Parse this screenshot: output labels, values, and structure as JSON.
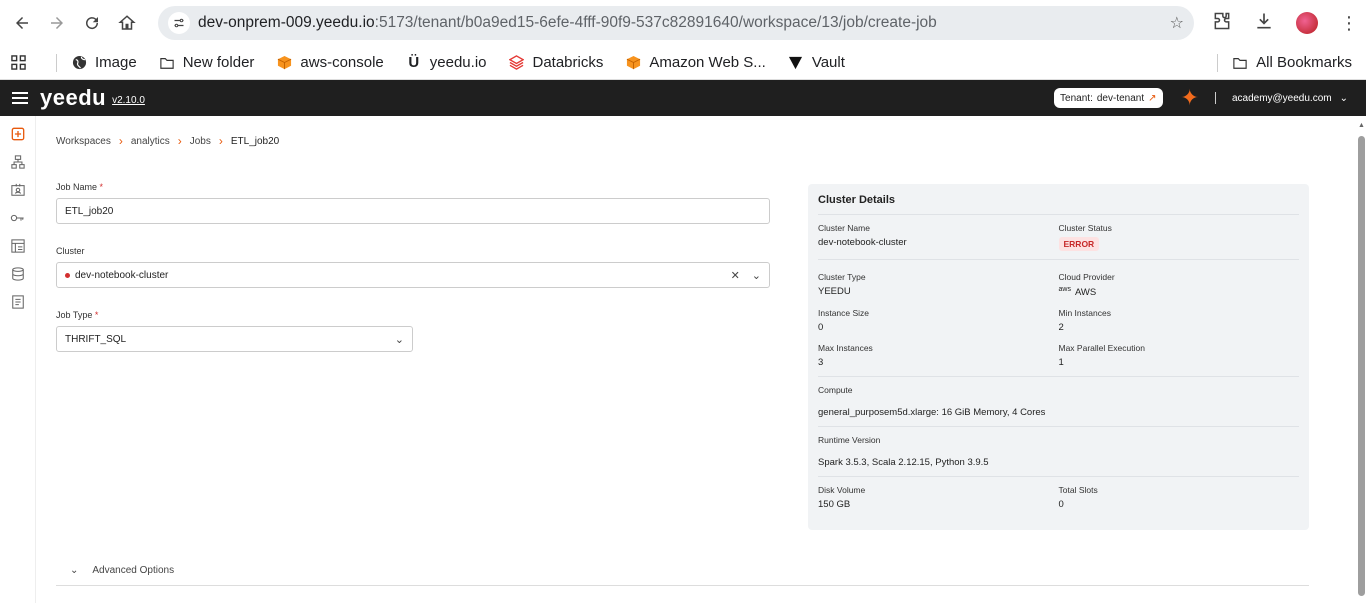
{
  "browser": {
    "url_host": "dev-onprem-009.yeedu.io",
    "url_path": ":5173/tenant/b0a9ed15-6efe-4fff-90f9-537c82891640/workspace/13/job/create-job"
  },
  "bookmarks": {
    "items": [
      "Image",
      "New folder",
      "aws-console",
      "yeedu.io",
      "Databricks",
      "Amazon Web S...",
      "Vault"
    ],
    "all": "All Bookmarks"
  },
  "header": {
    "logo": "yeedu",
    "version": "v2.10.0",
    "tenant_label": "Tenant:",
    "tenant_name": "dev-tenant",
    "user": "academy@yeedu.com"
  },
  "breadcrumb": [
    "Workspaces",
    "analytics",
    "Jobs",
    "ETL_job20"
  ],
  "form": {
    "job_name_label": "Job Name",
    "job_name_value": "ETL_job20",
    "cluster_label": "Cluster",
    "cluster_value": "dev-notebook-cluster",
    "job_type_label": "Job Type",
    "job_type_value": "THRIFT_SQL",
    "required_mark": "*"
  },
  "details": {
    "title": "Cluster Details",
    "cluster_name_k": "Cluster Name",
    "cluster_name_v": "dev-notebook-cluster",
    "cluster_status_k": "Cluster Status",
    "cluster_status_v": "ERROR",
    "cluster_type_k": "Cluster Type",
    "cluster_type_v": "YEEDU",
    "cloud_provider_k": "Cloud Provider",
    "cloud_provider_v": "AWS",
    "aws_logo": "aws",
    "instance_size_k": "Instance Size",
    "instance_size_v": "0",
    "min_instances_k": "Min Instances",
    "min_instances_v": "2",
    "max_instances_k": "Max Instances",
    "max_instances_v": "3",
    "max_parallel_k": "Max Parallel Execution",
    "max_parallel_v": "1",
    "compute_k": "Compute",
    "compute_v": "general_purposem5d.xlarge:  16 GiB Memory,  4 Cores",
    "runtime_k": "Runtime Version",
    "runtime_v": "Spark 3.5.3, Scala 2.12.15, Python 3.9.5",
    "disk_k": "Disk Volume",
    "disk_v": "150 GB",
    "slots_k": "Total Slots",
    "slots_v": "0"
  },
  "advanced": "Advanced Options",
  "colors": {
    "accent": "#e8590c",
    "error": "#c62828",
    "header_bg": "#1f1f1f"
  }
}
